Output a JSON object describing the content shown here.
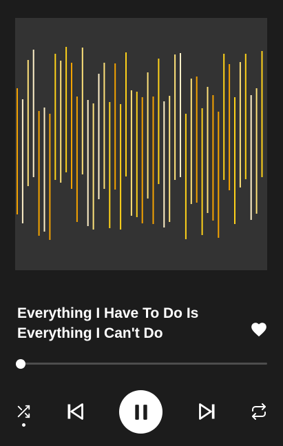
{
  "track": {
    "title": "Everything I Have To Do Is Everything I Can't Do",
    "liked": true
  },
  "artwork": {
    "background": "#333333",
    "palette": [
      "#f5a300",
      "#ffd21a",
      "#ffe27a",
      "#fff0c8"
    ],
    "icon": "waveform-bars"
  },
  "progress": {
    "fraction": 0.014
  },
  "controls": {
    "shuffle_icon": "shuffle-icon",
    "shuffle_active": true,
    "previous_icon": "skip-previous-icon",
    "play_state": "playing",
    "play_pause_icon": "pause-icon",
    "next_icon": "skip-next-icon",
    "repeat_icon": "repeat-icon"
  },
  "colors": {
    "background": "#1c1c1c",
    "foreground": "#ffffff",
    "track_inactive": "#4d4d4d"
  }
}
